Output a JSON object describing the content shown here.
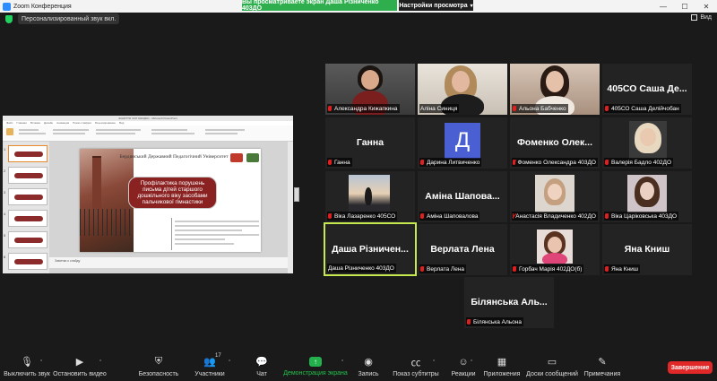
{
  "window": {
    "title": "Zoom Конференция",
    "controls": [
      "—",
      "☐",
      "✕"
    ]
  },
  "share_banner": {
    "text": "Вы просматриваете экран Даша Різниченко 403ДО",
    "view_options": "Настройки просмотра"
  },
  "info_bar": {
    "audio_status": "Персонализированный звук вкл.",
    "view_label": "Вид",
    "security_color": "#23d160"
  },
  "shared_screen": {
    "ppt_title": "ЗАНЯТТЯ ЧСП 6023ДО1 - Microsoft PowerPoint",
    "ribbon_tabs": [
      "Файл",
      "Главная",
      "Вставка",
      "Дизайн",
      "Анимация",
      "Показ слайдов",
      "Рецензирование",
      "Вид"
    ],
    "slide_header": "Бердянський Державний Педагогічний Університет",
    "slide_title": "Профілактика порушень письма дітей старшого дошкільного віку засобами пальчикової гімнастики",
    "notes_placeholder": "Заметки к слайду",
    "thumb_numbers": [
      "1",
      "2",
      "3",
      "4",
      "5",
      "6"
    ]
  },
  "participants": [
    {
      "name": "Александра Кижапкина",
      "display": "",
      "muted": true,
      "type": "video"
    },
    {
      "name": "Аліна Синиця",
      "display": "",
      "muted": false,
      "type": "video"
    },
    {
      "name": "Альона Бабченко",
      "display": "",
      "muted": true,
      "type": "video"
    },
    {
      "name": "405СО Саша Делійчобан",
      "display": "405СО Саша Де...",
      "muted": true,
      "type": "name"
    },
    {
      "name": "Ганна",
      "display": "Ганна",
      "muted": true,
      "type": "name"
    },
    {
      "name": "Дарина Литвиченко",
      "display": "",
      "muted": true,
      "type": "avatar",
      "avatar": "Д"
    },
    {
      "name": "Фоменко Олександра 403ДО",
      "display": "Фоменко Олек...",
      "muted": true,
      "type": "name"
    },
    {
      "name": "Валерія Бадло 402ДО",
      "display": "",
      "muted": true,
      "type": "video"
    },
    {
      "name": "Віка Лазаренко 405СО",
      "display": "",
      "muted": true,
      "type": "video"
    },
    {
      "name": "Аміна Шаповалова",
      "display": "Аміна Шапова...",
      "muted": true,
      "type": "name"
    },
    {
      "name": "Анастасія Владиченко 402ДО",
      "display": "",
      "muted": true,
      "type": "video"
    },
    {
      "name": "Віка Царіковська 403ДО",
      "display": "",
      "muted": true,
      "type": "video"
    },
    {
      "name": "Даша Різниченко 403ДО",
      "display": "Даша Різничен...",
      "muted": false,
      "type": "name",
      "active": true
    },
    {
      "name": "Верлата Лена",
      "display": "Верлата Лена",
      "muted": true,
      "type": "name"
    },
    {
      "name": "Горбач Марія 402ДО(б)",
      "display": "",
      "muted": true,
      "type": "video"
    },
    {
      "name": "Яна Книш",
      "display": "Яна Книш",
      "muted": true,
      "type": "name"
    },
    {
      "name": "Білянська Альона",
      "display": "Білянська Аль...",
      "muted": true,
      "type": "name"
    }
  ],
  "toolbar": {
    "mute": "Выключить звук",
    "video": "Остановить видео",
    "security": "Безопасность",
    "participants": "Участники",
    "participants_count": "17",
    "chat": "Чат",
    "share": "Демонстрация экрана",
    "record": "Запись",
    "captions": "Показ субтитры",
    "reactions": "Реакции",
    "apps": "Приложения",
    "whiteboards": "Доски сообщений",
    "notes": "Примечания",
    "end": "Завершение"
  },
  "colors": {
    "background": "#1a1a1a",
    "tile": "#232323",
    "active_border": "#c5e94e",
    "share_green": "#2fae4e",
    "end_red": "#e02828",
    "avatar_blue": "#4a5fd1",
    "slide_accent": "#8b2222"
  }
}
